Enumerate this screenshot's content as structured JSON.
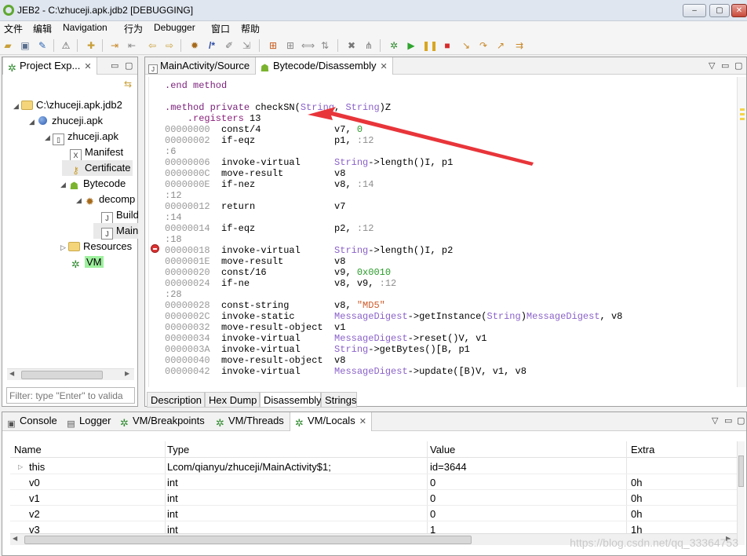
{
  "window": {
    "title": "JEB2 - C:\\zhuceji.apk.jdb2 [DEBUGGING]",
    "buttons": [
      "–",
      "▢",
      "✕"
    ]
  },
  "menu": [
    "文件",
    "编辑",
    "Navigation",
    "行为",
    "Debugger",
    "窗口",
    "帮助"
  ],
  "toolbar_icons": [
    "open-icon",
    "save-icon",
    "wrench-icon",
    "warning-icon",
    "new-file-icon",
    "import-icon",
    "export-icon",
    "back-icon",
    "forward-icon",
    "gears-icon",
    "comment-icon",
    "rename-icon",
    "navigate-icon",
    "grid-icon",
    "grid2-icon",
    "code-icon",
    "xref-icon",
    "delete-icon",
    "tree-icon",
    "debug-icon",
    "run-icon",
    "pause-icon",
    "stop-icon",
    "step-into-icon",
    "step-over-icon",
    "step-out-icon",
    "run-to-icon"
  ],
  "project": {
    "tab_label": "Project Exp...",
    "tree": [
      {
        "label": "C:\\zhuceji.apk.jdb2",
        "icon": "folder",
        "twisty": "◢"
      },
      {
        "label": "zhuceji.apk",
        "icon": "ball",
        "twisty": "◢"
      },
      {
        "label": "zhuceji.apk",
        "icon": "doc",
        "twisty": "◢"
      },
      {
        "label": "Manifest",
        "icon": "doc"
      },
      {
        "label": "Certificate",
        "icon": "key"
      },
      {
        "label": "Bytecode",
        "icon": "android",
        "twisty": "◢"
      },
      {
        "label": "decomp",
        "icon": "gears",
        "twisty": "◢"
      },
      {
        "label": "Build",
        "icon": "doc"
      },
      {
        "label": "Main",
        "icon": "doc"
      },
      {
        "label": "Resources",
        "icon": "folder",
        "twisty": "▷"
      },
      {
        "label": "VM",
        "icon": "bug"
      }
    ],
    "filter_placeholder": "Filter: type \"Enter\" to valida"
  },
  "editor": {
    "tabs": [
      {
        "label": "MainActivity/Source"
      },
      {
        "label": "Bytecode/Disassembly"
      }
    ],
    "bottom_tabs": [
      "Description",
      "Hex Dump",
      "Disassembly",
      "Strings"
    ],
    "lines": [
      [
        {
          "t": ".end method",
          "c": "c-kw"
        }
      ],
      [],
      [
        {
          "t": ".method private ",
          "c": "c-kw"
        },
        {
          "t": "checkSN("
        },
        {
          "t": "String",
          "c": "c-type"
        },
        {
          "t": ", "
        },
        {
          "t": "String",
          "c": "c-type"
        },
        {
          "t": ")Z"
        }
      ],
      [
        {
          "t": "    .registers ",
          "c": "c-dir"
        },
        {
          "t": "13"
        }
      ],
      [
        {
          "t": "00000000  ",
          "c": "c-addr"
        },
        {
          "t": "const/4             v7, "
        },
        {
          "t": "0",
          "c": "c-num"
        }
      ],
      [
        {
          "t": "00000002  ",
          "c": "c-addr"
        },
        {
          "t": "if-eqz              p1, "
        },
        {
          "t": ":12",
          "c": "c-lab"
        }
      ],
      [
        {
          "t": ":6",
          "c": "c-lab"
        }
      ],
      [
        {
          "t": "00000006  ",
          "c": "c-addr"
        },
        {
          "t": "invoke-virtual      "
        },
        {
          "t": "String",
          "c": "c-type"
        },
        {
          "t": "->length()I, p1"
        }
      ],
      [
        {
          "t": "0000000C  ",
          "c": "c-addr"
        },
        {
          "t": "move-result         v8"
        }
      ],
      [
        {
          "t": "0000000E  ",
          "c": "c-addr"
        },
        {
          "t": "if-nez              v8, "
        },
        {
          "t": ":14",
          "c": "c-lab"
        }
      ],
      [
        {
          "t": ":12",
          "c": "c-lab"
        }
      ],
      [
        {
          "t": "00000012  ",
          "c": "c-addr"
        },
        {
          "t": "return              v7"
        }
      ],
      [
        {
          "t": ":14",
          "c": "c-lab"
        }
      ],
      [
        {
          "t": "00000014  ",
          "c": "c-addr"
        },
        {
          "t": "if-eqz              p2, "
        },
        {
          "t": ":12",
          "c": "c-lab"
        }
      ],
      [
        {
          "t": ":18",
          "c": "c-lab"
        }
      ],
      [
        {
          "t": "00000018  ",
          "c": "c-addr"
        },
        {
          "t": "invoke-virtual      "
        },
        {
          "t": "String",
          "c": "c-type"
        },
        {
          "t": "->length()I, p2"
        }
      ],
      [
        {
          "t": "0000001E  ",
          "c": "c-addr"
        },
        {
          "t": "move-result         v8"
        }
      ],
      [
        {
          "t": "00000020  ",
          "c": "c-addr"
        },
        {
          "t": "const/16            v9, "
        },
        {
          "t": "0x0010",
          "c": "c-num"
        }
      ],
      [
        {
          "t": "00000024  ",
          "c": "c-addr"
        },
        {
          "t": "if-ne               v8, v9, "
        },
        {
          "t": ":12",
          "c": "c-lab"
        }
      ],
      [
        {
          "t": ":28",
          "c": "c-lab"
        }
      ],
      [
        {
          "t": "00000028  ",
          "c": "c-addr"
        },
        {
          "t": "const-string        v8, "
        },
        {
          "t": "\"MD5\"",
          "c": "c-str"
        }
      ],
      [
        {
          "t": "0000002C  ",
          "c": "c-addr"
        },
        {
          "t": "invoke-static       "
        },
        {
          "t": "MessageDigest",
          "c": "c-type"
        },
        {
          "t": "->getInstance("
        },
        {
          "t": "String",
          "c": "c-type"
        },
        {
          "t": ")"
        },
        {
          "t": "MessageDigest",
          "c": "c-type"
        },
        {
          "t": ", v8"
        }
      ],
      [
        {
          "t": "00000032  ",
          "c": "c-addr"
        },
        {
          "t": "move-result-object  v1"
        }
      ],
      [
        {
          "t": "00000034  ",
          "c": "c-addr"
        },
        {
          "t": "invoke-virtual      "
        },
        {
          "t": "MessageDigest",
          "c": "c-type"
        },
        {
          "t": "->reset()V, v1"
        }
      ],
      [
        {
          "t": "0000003A  ",
          "c": "c-addr"
        },
        {
          "t": "invoke-virtual      "
        },
        {
          "t": "String",
          "c": "c-type"
        },
        {
          "t": "->getBytes()[B, p1"
        }
      ],
      [
        {
          "t": "00000040  ",
          "c": "c-addr"
        },
        {
          "t": "move-result-object  v8"
        }
      ],
      [
        {
          "t": "00000042  ",
          "c": "c-addr"
        },
        {
          "t": "invoke-virtual      "
        },
        {
          "t": "MessageDigest",
          "c": "c-type"
        },
        {
          "t": "->update([B)V, v1, v8"
        }
      ]
    ]
  },
  "bottom_panel": {
    "tabs": [
      "Console",
      "Logger",
      "VM/Breakpoints",
      "VM/Threads",
      "VM/Locals"
    ],
    "columns": [
      "Name",
      "Type",
      "Value",
      "Extra"
    ],
    "rows": [
      {
        "name": "this",
        "type": "Lcom/qianyu/zhuceji/MainActivity$1;",
        "value": "id=3644",
        "extra": ""
      },
      {
        "name": "v0",
        "type": "int",
        "value": "0",
        "extra": "0h"
      },
      {
        "name": "v1",
        "type": "int",
        "value": "0",
        "extra": "0h"
      },
      {
        "name": "v2",
        "type": "int",
        "value": "0",
        "extra": "0h"
      },
      {
        "name": "v3",
        "type": "int",
        "value": "1",
        "extra": "1h"
      }
    ],
    "watermark": "https://blog.csdn.net/qq_33364753"
  },
  "colors": {
    "arrow": "#e8353a",
    "vm_highlight": "#9ff09f",
    "breakpoint": "#dd3333"
  }
}
